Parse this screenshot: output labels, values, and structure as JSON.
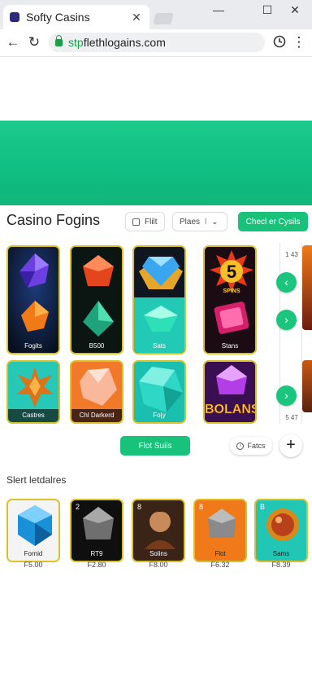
{
  "browser": {
    "tab_title": "Softy Casins",
    "tab_close": "✕",
    "win_min": "—",
    "win_max": "☐",
    "win_close": "✕",
    "back": "←",
    "reload": "↻",
    "url_scheme": "stp",
    "url_rest": "flethlogains.com",
    "more": "⋮"
  },
  "section": {
    "title": "Casino Fogins",
    "filter_label": "Flilt",
    "sort_label": "Plaes",
    "sort_value": "l",
    "cta_label": "Checl er Cysils"
  },
  "games_top": [
    {
      "label": "Fogits"
    },
    {
      "label": "B500"
    },
    {
      "label": "Sats"
    },
    {
      "label": "Stans"
    }
  ],
  "games_bottom": [
    {
      "label": "Castres"
    },
    {
      "label": "Chl Darkerd"
    },
    {
      "label": "Fo|y"
    },
    {
      "label": "BOLANS"
    }
  ],
  "slot_number": "5",
  "slot_caption": "SPINS",
  "scroll": {
    "top": "1 43",
    "bottom": "5 47"
  },
  "actions": {
    "primary_label": "Flot Suiis",
    "filter_label": "Fatcs",
    "add": "+"
  },
  "shelf": {
    "title": "Slert letdalres",
    "items": [
      {
        "label": "Fornid",
        "price": "F5.00",
        "corner": ""
      },
      {
        "label": "RT9",
        "price": "F2.80",
        "corner": "2"
      },
      {
        "label": "Solins",
        "price": "F8.00",
        "corner": "8"
      },
      {
        "label": "Flot",
        "price": "F6.32",
        "corner": "8"
      },
      {
        "label": "Sams",
        "price": "F8.39",
        "corner": "B"
      }
    ]
  },
  "colors": {
    "accent": "#19c27a",
    "hero": "#10bf83",
    "tile_border": "#d8c12a"
  }
}
